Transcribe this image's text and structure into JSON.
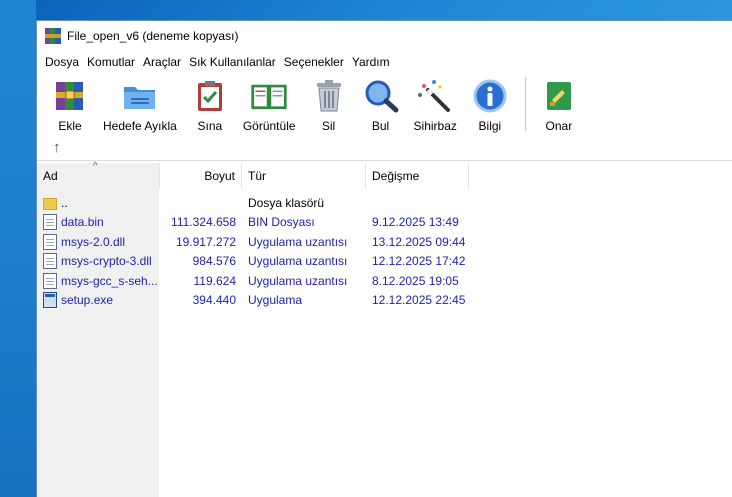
{
  "window": {
    "title": "File_open_v6 (deneme kopyası)"
  },
  "menu": [
    "Dosya",
    "Komutlar",
    "Araçlar",
    "Sık Kullanılanlar",
    "Seçenekler",
    "Yardım"
  ],
  "toolbar": {
    "add": "Ekle",
    "extract": "Hedefe Ayıkla",
    "test": "Sına",
    "view": "Görüntüle",
    "delete": "Sil",
    "find": "Bul",
    "wizard": "Sihirbaz",
    "info": "Bilgi",
    "repair": "Onar"
  },
  "columns": {
    "name": "Ad",
    "size": "Boyut",
    "type": "Tür",
    "modified": "Değişme"
  },
  "files": [
    {
      "name": "..",
      "size": "",
      "type": "Dosya klasörü",
      "date": "",
      "icon": "folder-icon"
    },
    {
      "name": "data.bin",
      "size": "111.324.658",
      "type": "BIN Dosyası",
      "date": "9.12.2025 13:49",
      "icon": "file-icon"
    },
    {
      "name": "msys-2.0.dll",
      "size": "19.917.272",
      "type": "Uygulama uzantısı",
      "date": "13.12.2025 09:44",
      "icon": "dll-icon"
    },
    {
      "name": "msys-crypto-3.dll",
      "size": "984.576",
      "type": "Uygulama uzantısı",
      "date": "12.12.2025 17:42",
      "icon": "dll-icon"
    },
    {
      "name": "msys-gcc_s-seh...",
      "size": "119.624",
      "type": "Uygulama uzantısı",
      "date": "8.12.2025 19:05",
      "icon": "dll-icon"
    },
    {
      "name": "setup.exe",
      "size": "394.440",
      "type": "Uygulama",
      "date": "12.12.2025 22:45",
      "icon": "exe-icon"
    }
  ]
}
